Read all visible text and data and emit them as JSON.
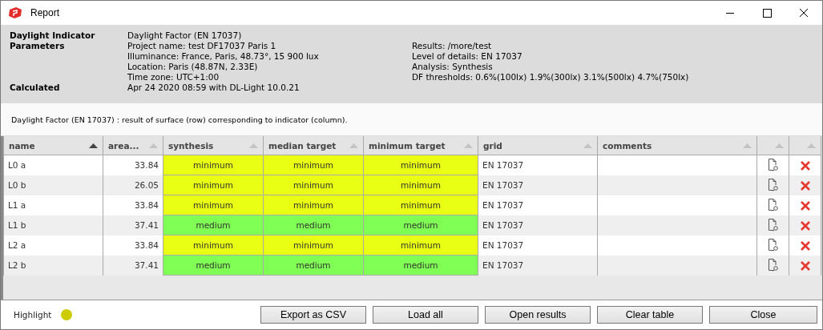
{
  "window": {
    "title": "Report"
  },
  "info": {
    "indicator": {
      "label": "Daylight Indicator",
      "value": "Daylight Factor (EN 17037)"
    },
    "parameters": {
      "label": "Parameters",
      "left": [
        "Project name: test DF17037 Paris 1",
        "Illuminance: France, Paris, 48.73°, 15 900 lux",
        "Location: Paris (48.87N, 2.33E)",
        "Time zone: UTC+1:00"
      ],
      "right": [
        "Results: /more/test",
        "Level of details: EN 17037",
        "Analysis: Synthesis",
        "DF thresholds: 0.6%(100lx) 1.9%(300lx) 3.1%(500lx) 4.7%(750lx)"
      ]
    },
    "calculated": {
      "label": "Calculated",
      "value": "Apr 24 2020 08:59 with DL-Light 10.0.21"
    }
  },
  "description": "Daylight Factor (EN 17037) : result of surface (row) corresponding to indicator (column).",
  "table": {
    "columns": [
      {
        "label": "name",
        "sorted": true
      },
      {
        "label": "area...",
        "sorted": false
      },
      {
        "label": "synthesis",
        "sorted": false
      },
      {
        "label": "median target",
        "sorted": false
      },
      {
        "label": "minimum target",
        "sorted": false
      },
      {
        "label": "grid",
        "sorted": false
      },
      {
        "label": "comments",
        "sorted": false
      },
      {
        "sorted": false
      },
      {
        "sorted": false
      }
    ],
    "rows": [
      {
        "name": "L0 a",
        "area": "33.84",
        "results": [
          {
            "text": "minimum",
            "color": "#e9ff13"
          },
          {
            "text": "minimum",
            "color": "#e9ff13"
          },
          {
            "text": "minimum",
            "color": "#e9ff13"
          }
        ],
        "grid": "EN 17037"
      },
      {
        "name": "L0 b",
        "area": "26.05",
        "results": [
          {
            "text": "minimum",
            "color": "#e9ff13"
          },
          {
            "text": "minimum",
            "color": "#e9ff13"
          },
          {
            "text": "minimum",
            "color": "#e9ff13"
          }
        ],
        "grid": "EN 17037"
      },
      {
        "name": "L1 a",
        "area": "33.84",
        "results": [
          {
            "text": "minimum",
            "color": "#e9ff13"
          },
          {
            "text": "minimum",
            "color": "#e9ff13"
          },
          {
            "text": "minimum",
            "color": "#e9ff13"
          }
        ],
        "grid": "EN 17037"
      },
      {
        "name": "L1 b",
        "area": "37.41",
        "results": [
          {
            "text": "medium",
            "color": "#80ff55"
          },
          {
            "text": "medium",
            "color": "#80ff55"
          },
          {
            "text": "medium",
            "color": "#80ff55"
          }
        ],
        "grid": "EN 17037"
      },
      {
        "name": "L2 a",
        "area": "33.84",
        "results": [
          {
            "text": "minimum",
            "color": "#e9ff13"
          },
          {
            "text": "minimum",
            "color": "#e9ff13"
          },
          {
            "text": "minimum",
            "color": "#e9ff13"
          }
        ],
        "grid": "EN 17037"
      },
      {
        "name": "L2 b",
        "area": "37.41",
        "results": [
          {
            "text": "medium",
            "color": "#80ff55"
          },
          {
            "text": "medium",
            "color": "#80ff55"
          },
          {
            "text": "medium",
            "color": "#80ff55"
          }
        ],
        "grid": "EN 17037"
      }
    ]
  },
  "highlight": {
    "label": "Highlight",
    "color": "#cccc00"
  },
  "buttons": [
    "Export as CSV",
    "Load all",
    "Open results",
    "Clear table",
    "Close"
  ]
}
